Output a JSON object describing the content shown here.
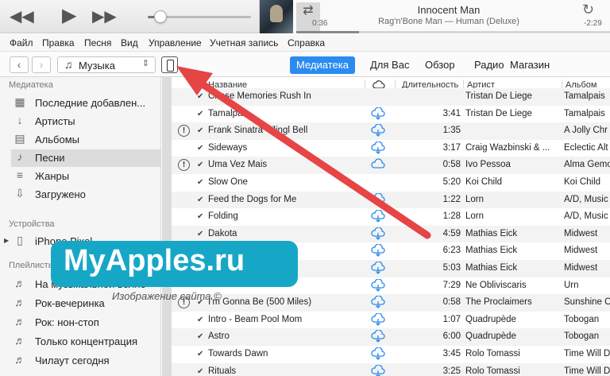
{
  "player": {
    "track_title": "Innocent Man",
    "track_subtitle": "Rag'n'Bone Man — Human (Deluxe)",
    "elapsed": "0:36",
    "remaining": "-2:29",
    "progress_fraction": 0.2,
    "volume_fraction": 0.12
  },
  "menu": [
    "Файл",
    "Правка",
    "Песня",
    "Вид",
    "Управление",
    "Учетная запись",
    "Справка"
  ],
  "nav": {
    "library_select": "Музыка",
    "tabs": [
      "Медиатека",
      "Для Вас",
      "Обзор",
      "Радио",
      "Магазин"
    ],
    "active_tab": "Медиатека"
  },
  "sidebar": {
    "library_header": "Медиатека",
    "library_items": [
      {
        "label": "Последние добавлен...",
        "icon": "recently-added-icon"
      },
      {
        "label": "Артисты",
        "icon": "microphone-icon"
      },
      {
        "label": "Альбомы",
        "icon": "album-icon"
      },
      {
        "label": "Песни",
        "icon": "music-note-icon"
      },
      {
        "label": "Жанры",
        "icon": "genres-icon"
      },
      {
        "label": "Загружено",
        "icon": "download-icon"
      }
    ],
    "devices_header": "Устройства",
    "devices": [
      {
        "label": "iPhone Pixel",
        "icon": "iphone-icon"
      }
    ],
    "playlists_header": "Плейлисты",
    "playlists": [
      {
        "label": "На музыкальной волне",
        "icon": "playlist-icon"
      },
      {
        "label": "Рок-вечеринка",
        "icon": "playlist-icon"
      },
      {
        "label": "Рок: нон-стоп",
        "icon": "playlist-icon"
      },
      {
        "label": "Только концентрация",
        "icon": "playlist-icon"
      },
      {
        "label": "Чилаут сегодня",
        "icon": "playlist-icon"
      }
    ]
  },
  "table": {
    "headers": {
      "name": "Название",
      "duration": "Длительность",
      "artist": "Артист",
      "album": "Альбом"
    },
    "rows": [
      {
        "name": "Chase Memories Rush In",
        "duration": "",
        "artist": "Tristan De Liege",
        "album": "Tamalpais",
        "warn": false,
        "cloud": "none"
      },
      {
        "name": "Tamalpais",
        "duration": "3:41",
        "artist": "Tristan De Liege",
        "album": "Tamalpais",
        "warn": false,
        "cloud": "download"
      },
      {
        "name": "Frank Sinatra - Jingl Bell",
        "duration": "1:35",
        "artist": "",
        "album": "A Jolly Chr",
        "warn": true,
        "cloud": "download"
      },
      {
        "name": "Sideways",
        "duration": "3:17",
        "artist": "Craig Wazbinski & ...",
        "album": "Eclectic Alt",
        "warn": false,
        "cloud": "download"
      },
      {
        "name": "Uma Vez Mais",
        "duration": "0:58",
        "artist": "Ivo Pessoa",
        "album": "Alma Gemo",
        "warn": true,
        "cloud": "cloud"
      },
      {
        "name": "Slow One",
        "duration": "5:20",
        "artist": "Koi Child",
        "album": "Koi Child",
        "warn": false,
        "cloud": "none"
      },
      {
        "name": "Feed the Dogs for Me",
        "duration": "1:22",
        "artist": "Lorn",
        "album": "A/D, Music",
        "warn": false,
        "cloud": "download"
      },
      {
        "name": "Folding",
        "duration": "1:28",
        "artist": "Lorn",
        "album": "A/D, Music",
        "warn": false,
        "cloud": "download"
      },
      {
        "name": "Dakota",
        "duration": "4:59",
        "artist": "Mathias Eick",
        "album": "Midwest",
        "warn": false,
        "cloud": "download"
      },
      {
        "name": "",
        "duration": "6:23",
        "artist": "Mathias Eick",
        "album": "Midwest",
        "warn": false,
        "cloud": "download"
      },
      {
        "name": "",
        "duration": "5:03",
        "artist": "Mathias Eick",
        "album": "Midwest",
        "warn": false,
        "cloud": "download"
      },
      {
        "name": "",
        "duration": "7:29",
        "artist": "Ne Obliviscaris",
        "album": "Urn",
        "warn": false,
        "cloud": "download"
      },
      {
        "name": "I'm Gonna Be (500 Miles)",
        "duration": "0:58",
        "artist": "The Proclaimers",
        "album": "Sunshine O",
        "warn": true,
        "cloud": "download"
      },
      {
        "name": "Intro - Beam Pool Mom",
        "duration": "1:07",
        "artist": "Quadrupède",
        "album": "Tobogan",
        "warn": false,
        "cloud": "download"
      },
      {
        "name": "Astro",
        "duration": "6:00",
        "artist": "Quadrupède",
        "album": "Tobogan",
        "warn": false,
        "cloud": "download"
      },
      {
        "name": "Towards Dawn",
        "duration": "3:45",
        "artist": "Rolo Tomassi",
        "album": "Time Will D",
        "warn": false,
        "cloud": "download"
      },
      {
        "name": "Rituals",
        "duration": "3:25",
        "artist": "Rolo Tomassi",
        "album": "Time Will D",
        "warn": false,
        "cloud": "download"
      }
    ]
  },
  "watermark": {
    "text": "MyApples.ru",
    "caption": "Изображение сайта ©",
    "color": "#16a7c7"
  },
  "accent_color": "#2a8bf0",
  "arrow_color": "#e64545"
}
